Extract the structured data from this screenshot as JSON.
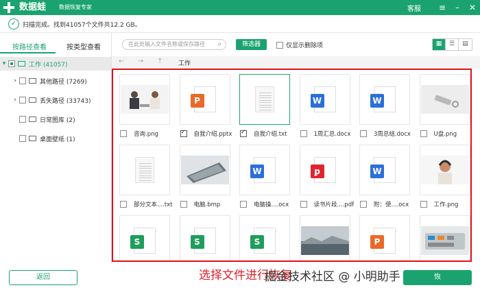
{
  "app": {
    "brand": "数据蛙",
    "subtitle": "数据恢复专家",
    "service": "客服"
  },
  "status": {
    "text": "扫描完成。找到41057个文件共12.2 GB。"
  },
  "sidebar": {
    "tabs": [
      "按路径查看",
      "按类型查看"
    ],
    "root": {
      "label": "工作 (41057)"
    },
    "items": [
      {
        "label": "其他路径 (7269)",
        "expandable": true
      },
      {
        "label": "丢失路径 (33743)",
        "expandable": true
      },
      {
        "label": "日常图库 (2)",
        "expandable": false
      },
      {
        "label": "桌面壁纸 (1)",
        "expandable": false
      }
    ]
  },
  "toolbar": {
    "search_placeholder": "在此处输入文件名称或保存路径",
    "filter_label": "筛选器",
    "only_deleted_label": "仅显示删除项"
  },
  "nav": {
    "path": "工作"
  },
  "files": [
    {
      "name": "咨询.png",
      "kind": "photo-meeting",
      "checked": false
    },
    {
      "name": "自我介绍.pptx",
      "kind": "ppt",
      "checked": true
    },
    {
      "name": "自我介绍.txt",
      "kind": "txt",
      "checked": true,
      "selected": true
    },
    {
      "name": "1周汇总.docx",
      "kind": "word",
      "checked": false
    },
    {
      "name": "3周总结.docx",
      "kind": "word",
      "checked": false
    },
    {
      "name": "U盘.png",
      "kind": "photo-usb",
      "checked": false
    },
    {
      "name": "部分文本....txt",
      "kind": "txt",
      "checked": false
    },
    {
      "name": "电脑.bmp",
      "kind": "photo-laptop",
      "checked": false
    },
    {
      "name": "电脑操....ocx",
      "kind": "word",
      "checked": false
    },
    {
      "name": "读书片段....pdf",
      "kind": "pdf",
      "checked": false
    },
    {
      "name": "附：使....ocx",
      "kind": "word",
      "checked": false
    },
    {
      "name": "工作.png",
      "kind": "photo-headset",
      "checked": false
    },
    {
      "name": "",
      "kind": "sheet",
      "checked": false
    },
    {
      "name": "",
      "kind": "sheet",
      "checked": false
    },
    {
      "name": "",
      "kind": "sheet",
      "checked": false
    },
    {
      "name": "",
      "kind": "photo-landscape",
      "checked": false
    },
    {
      "name": "",
      "kind": "ppt",
      "checked": false
    },
    {
      "name": "",
      "kind": "photo-keyboard",
      "checked": false
    }
  ],
  "bottom": {
    "back_label": "返回",
    "restore_label": "恢",
    "hint": "选择文件进行恢复",
    "watermark": "掘金技术社区 @ 小明助手"
  },
  "colors": {
    "brand": "#1aa370",
    "word": "#2b6fd9",
    "ppt": "#e96a28",
    "pdf": "#e0242f",
    "sheet": "#1f9d5c",
    "highlight": "#e0101a"
  }
}
